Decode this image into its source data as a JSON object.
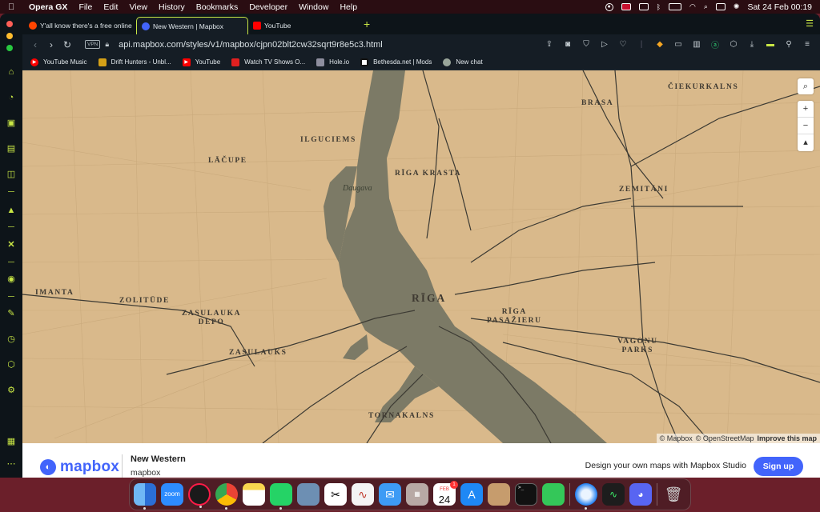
{
  "menubar": {
    "app": "Opera GX",
    "items": [
      "File",
      "Edit",
      "View",
      "History",
      "Bookmarks",
      "Developer",
      "Window",
      "Help"
    ],
    "clock": "Sat 24 Feb  00:19"
  },
  "tabs": [
    {
      "title": "Y'all know there's a free online"
    },
    {
      "title": "New Western | Mapbox"
    },
    {
      "title": "YouTube"
    }
  ],
  "toolbar": {
    "vpn_label": "VPN",
    "url": "api.mapbox.com/styles/v1/mapbox/cjpn02blt2cw32sqrt9r8e5c3.html"
  },
  "bookmarks": [
    {
      "label": "YouTube Music"
    },
    {
      "label": "Drift Hunters - Unbl..."
    },
    {
      "label": "YouTube"
    },
    {
      "label": "Watch TV Shows O..."
    },
    {
      "label": "Hole.io"
    },
    {
      "label": "Bethesda.net | Mods"
    },
    {
      "label": "New chat"
    }
  ],
  "map": {
    "labels": {
      "brasa": "BRASA",
      "ciekurkalns": "ČIEKURKALNS",
      "ilguciems": "ILGUCIEMS",
      "lacupe": "LĀČUPE",
      "riga_krasta": "RĪGA KRASTA",
      "zemitani": "ZEMITĀNI",
      "imanta": "IMANTA",
      "zolitude": "ZOLITŪDE",
      "riga": "RĪGA",
      "zasulauka_depo": "ZASULAUKA\nDEPO",
      "riga_pasazieru": "RĪGA\nPASAŽIERU",
      "vagonu_parks": "VAGONU\nPARKS",
      "zasulauks": "ZASULAUKS",
      "tornakalns": "TORNAKALNS"
    },
    "water_label": "Daugava",
    "colors": {
      "land": "#d9b98b",
      "water": "#7c7a66",
      "roads": "#3c3a33"
    },
    "attribution": {
      "mapbox": "© Mapbox",
      "osm": "© OpenStreetMap",
      "improve": "Improve this map"
    }
  },
  "footer": {
    "logo_text": "mapbox",
    "style_name": "New Western",
    "owner": "mapbox",
    "promo": "Design your own maps with Mapbox Studio",
    "signup_label": "Sign up"
  },
  "dock": {
    "calendar_month": "FEB",
    "calendar_day": "24",
    "calendar_badge": "1",
    "zoom_label": "zoom"
  }
}
